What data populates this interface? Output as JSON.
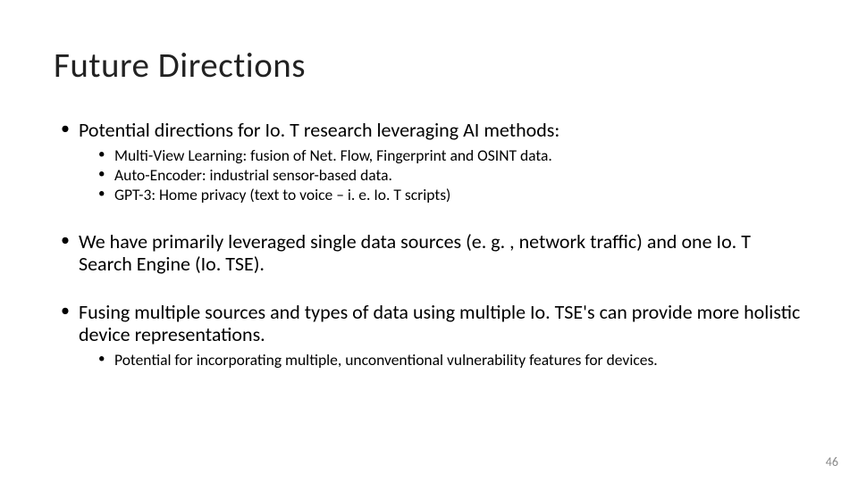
{
  "title": "Future Directions",
  "bullets": [
    {
      "text": "Potential directions for Io. T research leveraging AI methods:",
      "children": [
        "Multi-View Learning: fusion of Net. Flow, Fingerprint and OSINT data.",
        "Auto-Encoder: industrial sensor-based data.",
        "GPT-3: Home privacy (text to voice – i. e. Io. T scripts)"
      ]
    },
    {
      "text": "We have primarily leveraged single data sources (e. g. , network traffic) and one Io. T Search Engine (Io. TSE).",
      "children": []
    },
    {
      "text": "Fusing multiple sources and types of data using multiple Io. TSE's can provide more holistic device representations.",
      "children": [
        "Potential for incorporating multiple, unconventional vulnerability features for devices."
      ]
    }
  ],
  "page_number": "46"
}
